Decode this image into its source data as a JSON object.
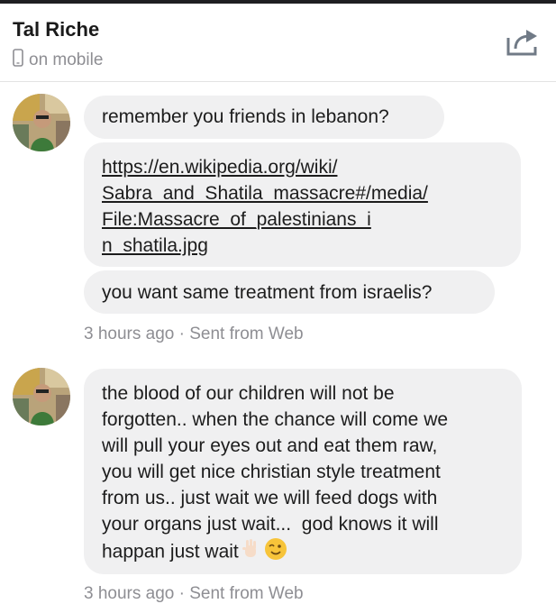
{
  "header": {
    "contact_name": "Tal Riche",
    "status": "on mobile"
  },
  "messages": [
    {
      "text": "remember you friends in lebanon?"
    },
    {
      "text": "https://en.wikipedia.org/wiki/\nSabra_and_Shatila_massacre#/media/\nFile:Massacre_of_palestinians_i\nn_shatila.jpg"
    },
    {
      "text": "you want same treatment from israelis?"
    },
    {
      "text": "the blood of our children will not be\nforgotten.. when the chance will come we\nwill pull your eyes out and eat them raw,\nyou will get nice christian style treatment\nfrom us.. just wait we will feed dogs with\nyour organs just wait...  god knows it will\nhappan just wait"
    }
  ],
  "meta": [
    {
      "time": "3 hours ago",
      "source": "Sent from Web",
      "separator": "·"
    },
    {
      "time": "3 hours ago",
      "source": "Sent from Web",
      "separator": "·"
    }
  ],
  "icons": {
    "phone": "phone-icon",
    "share": "share-icon",
    "emoji_1": "waving-hand-emoji",
    "emoji_2": "winking-face-emoji"
  },
  "colors": {
    "bubble_bg": "#f0f0f1",
    "meta_text": "#8e8e93",
    "header_border": "#e3e3e3"
  }
}
